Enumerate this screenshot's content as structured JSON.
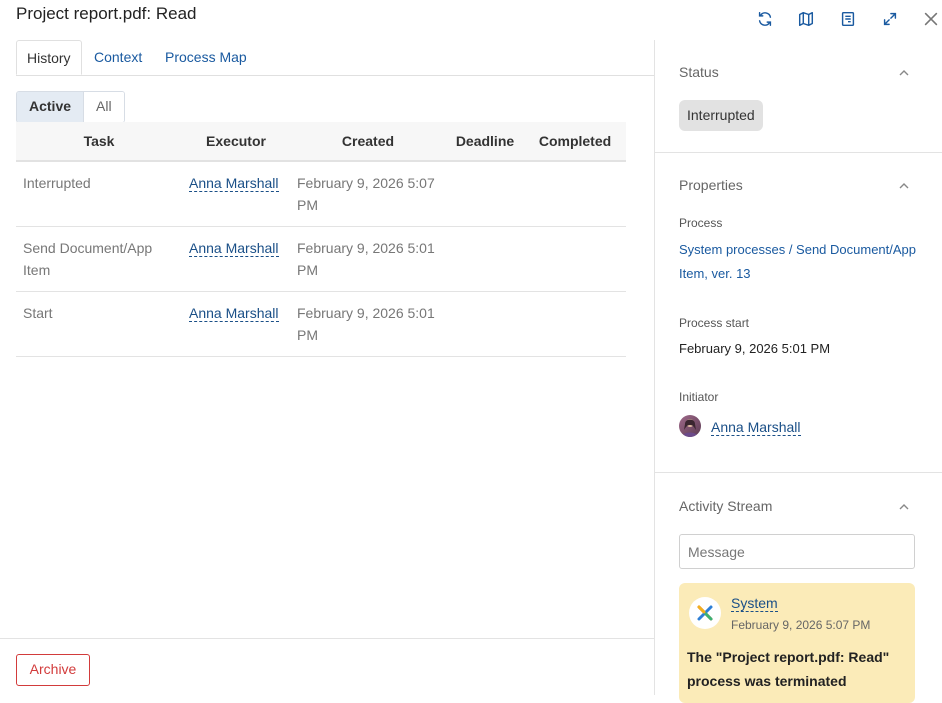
{
  "window": {
    "title": "Project report.pdf: Read"
  },
  "top_icons": [
    "refresh-icon",
    "map-icon",
    "document-icon",
    "expand-icon",
    "close-icon"
  ],
  "tabs": [
    {
      "label": "History"
    },
    {
      "label": "Context"
    },
    {
      "label": "Process Map"
    }
  ],
  "filter": {
    "active_label": "Active",
    "all_label": "All"
  },
  "table": {
    "columns": [
      "Task",
      "Executor",
      "Created",
      "Deadline",
      "Completed"
    ],
    "rows": [
      {
        "task": "Interrupted",
        "executor": "Anna Marshall",
        "created": "February 9, 2026 5:07 PM",
        "deadline": "",
        "completed": ""
      },
      {
        "task": "Send Document/App Item",
        "executor": "Anna Marshall",
        "created": "February 9, 2026 5:01 PM",
        "deadline": "",
        "completed": ""
      },
      {
        "task": "Start",
        "executor": "Anna Marshall",
        "created": "February 9, 2026 5:01 PM",
        "deadline": "",
        "completed": ""
      }
    ]
  },
  "footer": {
    "archive_label": "Archive"
  },
  "sidebar": {
    "status": {
      "title": "Status",
      "value": "Interrupted"
    },
    "properties": {
      "title": "Properties",
      "process_label": "Process",
      "process_link_1": "System processes",
      "process_sep": " / ",
      "process_link_2": "Send Document/App Item, ver. 13",
      "start_label": "Process start",
      "start_value": "February 9, 2026 5:01 PM",
      "initiator_label": "Initiator",
      "initiator_name": "Anna Marshall"
    },
    "activity": {
      "title": "Activity Stream",
      "message_placeholder": "Message",
      "entry": {
        "author": "System",
        "time": "February 9, 2026 5:07 PM",
        "text": "The \"Project report.pdf: Read\" process was terminated"
      }
    }
  },
  "colors": {
    "accent": "#1a5aa0",
    "danger": "#e03a3a",
    "card": "#fbebb8"
  }
}
